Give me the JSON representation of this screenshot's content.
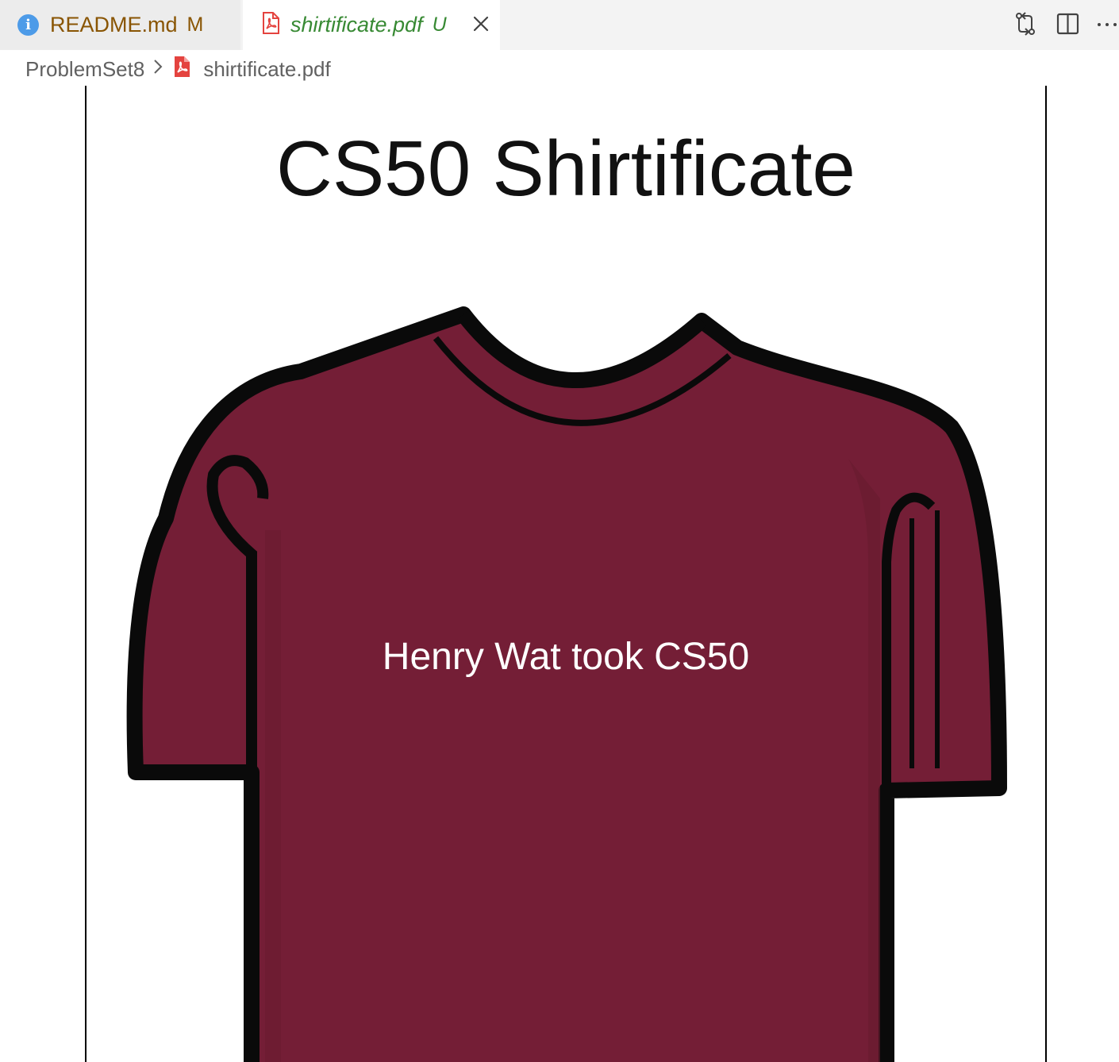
{
  "tabs": [
    {
      "label": "README.md",
      "status": "M",
      "icon": "info-icon"
    },
    {
      "label": "shirtificate.pdf",
      "status": "U",
      "icon": "pdf-icon",
      "active": true
    }
  ],
  "toolbar": {
    "icons": [
      "compare-changes-icon",
      "split-editor-icon",
      "more-actions-icon"
    ]
  },
  "breadcrumb": {
    "folder": "ProblemSet8",
    "file": "shirtificate.pdf"
  },
  "pdf": {
    "title": "CS50 Shirtificate",
    "shirt_text": "Henry Wat took CS50"
  },
  "colors": {
    "shirt": "#741e36",
    "pdf_icon": "#e4433f",
    "modified": "#895503",
    "untracked": "#388a34"
  }
}
